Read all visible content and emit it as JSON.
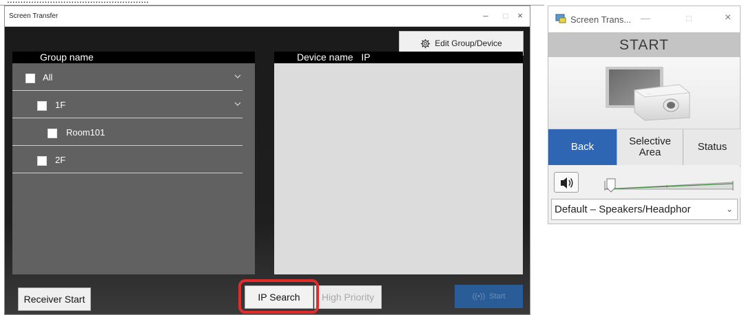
{
  "top_strip": {
    "text": "....................................................."
  },
  "main_window": {
    "title": "Screen Transfer",
    "controls": {
      "minimize": "–",
      "maximize": "□",
      "close": "×"
    },
    "edit_button": "Edit Group/Device",
    "group_panel": {
      "header": "Group name",
      "rows": [
        {
          "label": "All",
          "expandable": true
        },
        {
          "label": "1F",
          "expandable": true
        },
        {
          "label": "Room101",
          "expandable": false
        },
        {
          "label": "2F",
          "expandable": false
        }
      ]
    },
    "device_panel": {
      "header": "Device name   IP"
    },
    "buttons": {
      "receiver_start": "Receiver Start",
      "ip_search": "IP Search",
      "high_priority": "High Priority",
      "start": "Start"
    },
    "colors": {
      "highlight": "#e32b2b",
      "start_button": "#2a5d97"
    }
  },
  "mini_window": {
    "title": "Screen Trans...",
    "controls": {
      "minimize": "—",
      "maximize": "□",
      "close": "×"
    },
    "start_label": "START",
    "buttons": {
      "back": "Back",
      "selective_area": "Selective Area",
      "status": "Status"
    },
    "audio_device": "Default – Speakers/Headphor",
    "colors": {
      "back_button": "#2e66b4"
    }
  }
}
